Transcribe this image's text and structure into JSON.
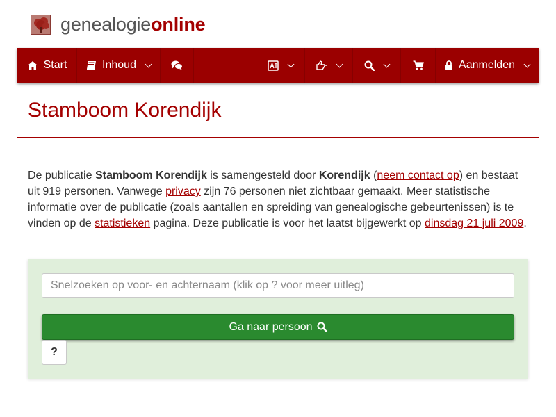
{
  "logo": {
    "text_part1": "genealogie",
    "text_part2": "online",
    "icon": "tree-logo-icon"
  },
  "nav": {
    "start_label": "Start",
    "start_icon": "home-icon",
    "inhoud_label": "Inhoud",
    "inhoud_icon": "book-icon",
    "chat_icon": "comments-icon",
    "language_icon": "language-icon",
    "share_icon": "share-icon",
    "search_icon": "search-icon",
    "cart_icon": "shopping-cart-icon",
    "login_label": "Aanmelden",
    "login_icon": "lock-icon"
  },
  "page": {
    "title": "Stamboom Korendijk"
  },
  "intro": {
    "t1": "De publicatie ",
    "pub_name": "Stamboom Korendijk",
    "t2": " is samengesteld door ",
    "author": "Korendijk",
    "t3": " (",
    "contact_link": "neem contact op",
    "t4": ") en bestaat uit 919 personen. Vanwege ",
    "privacy_link": "privacy",
    "t5": " zijn 76 personen niet zichtbaar gemaakt. Meer statistische informatie over de publicatie (zoals aantallen en spreiding van genealogische gebeurtenissen) is te vinden op de ",
    "stats_link": "statistieken",
    "t6": " pagina. Deze publicatie is voor het laatst bijgewerkt op ",
    "date_link": "dinsdag 21 juli 2009",
    "t7": "."
  },
  "search": {
    "placeholder": "Snelzoeken op voor- en achternaam (klik op ? voor meer uitleg)",
    "value": "",
    "go_label": "Ga naar persoon",
    "help_label": "?"
  },
  "colors": {
    "brand": "#9b0000",
    "panel_bg": "#e0efdb",
    "button_green": "#2a8a2f"
  }
}
